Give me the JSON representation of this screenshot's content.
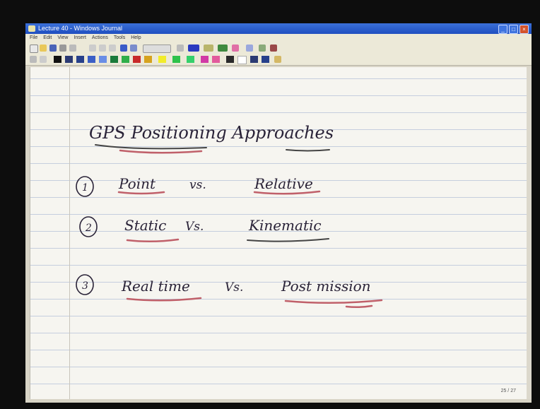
{
  "window": {
    "title": "Lecture 40 - Windows Journal",
    "menu": [
      "File",
      "Edit",
      "View",
      "Insert",
      "Actions",
      "Tools",
      "Help"
    ]
  },
  "toolbar_icons": [
    "new-page-icon",
    "open-icon",
    "save-icon",
    "print-icon",
    "find-icon",
    "undo-icon",
    "redo-icon",
    "pen-icon",
    "highlighter-icon",
    "eraser-icon",
    "lasso-icon",
    "insert-space-icon",
    "flag-icon"
  ],
  "palette": [
    "#111111",
    "#2b3a73",
    "#27408b",
    "#3b5fc6",
    "#6a8ee6",
    "#1a7a3a",
    "#2fae4a",
    "#c82a2a",
    "#d6a21e",
    "#f2ec2a",
    "#2ec24a",
    "#35d06b",
    "#d13aa6",
    "#e25a9c",
    "#2a2a2a",
    "#ffffff",
    "#2b3a73",
    "#27408b"
  ],
  "note": {
    "title": "GPS Positioning Approaches",
    "items": [
      {
        "marker": "1",
        "left": "Point",
        "vs": "vs.",
        "right": "Relative"
      },
      {
        "marker": "2",
        "left": "Static",
        "vs": "Vs.",
        "right": "Kinematic"
      },
      {
        "marker": "3",
        "left": "Real time",
        "vs": "Vs.",
        "right": "Post mission"
      }
    ]
  },
  "page_number": "25 / 27"
}
